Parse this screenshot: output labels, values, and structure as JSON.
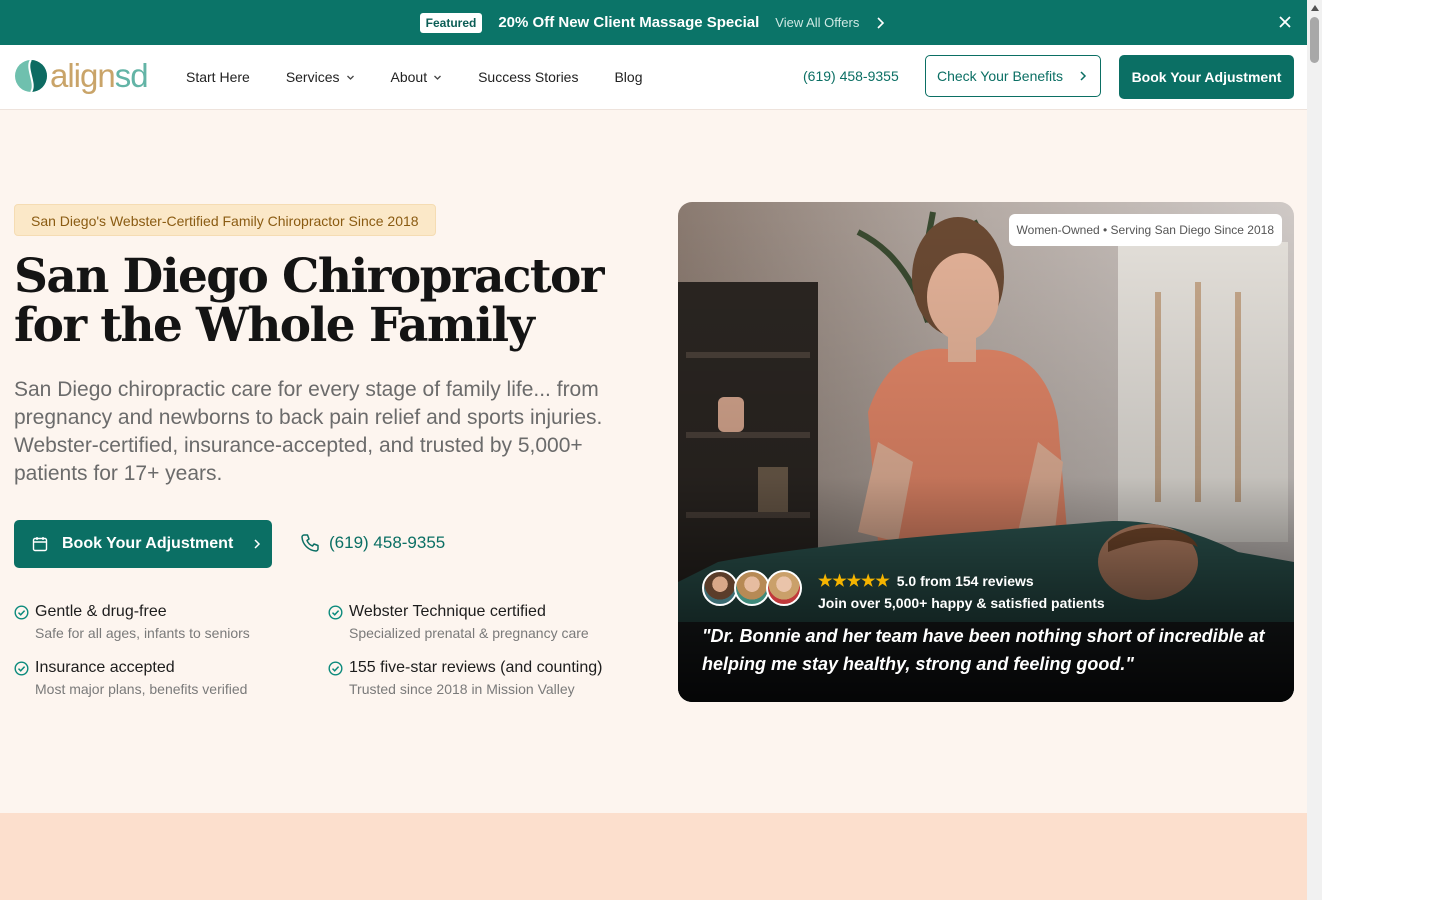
{
  "promo": {
    "badge": "Featured",
    "headline": "20% Off New Client Massage Special",
    "link": "View All Offers"
  },
  "nav": {
    "logo": {
      "part1": "align",
      "part2": "sd"
    },
    "items": [
      {
        "label": "Start Here",
        "has_caret": false
      },
      {
        "label": "Services",
        "has_caret": true
      },
      {
        "label": "About",
        "has_caret": true
      },
      {
        "label": "Success Stories",
        "has_caret": false
      },
      {
        "label": "Blog",
        "has_caret": false
      }
    ],
    "phone": "(619) 458-9355",
    "benefits_label": "Check Your Benefits",
    "book_label": "Book Your Adjustment"
  },
  "hero": {
    "tagline": "San Diego's Webster-Certified Family Chiropractor Since 2018",
    "title_line1": "San Diego Chiropractor",
    "title_line2": "for the Whole Family",
    "lead": "San Diego chiropractic care for every stage of family life... from pregnancy and newborns to back pain relief and sports injuries. Webster-certified, insurance-accepted, and trusted by 5,000+ patients for 17+ years.",
    "book_label": "Book Your Adjustment",
    "phone": "(619) 458-9355",
    "features": [
      {
        "title": "Gentle & drug-free",
        "sub": "Safe for all ages, infants to seniors"
      },
      {
        "title": "Webster Technique certified",
        "sub": "Specialized prenatal & pregnancy care"
      },
      {
        "title": "Insurance accepted",
        "sub": "Most major plans, benefits verified"
      },
      {
        "title": "155 five-star reviews (and counting)",
        "sub": "Trusted since 2018 in Mission Valley"
      }
    ]
  },
  "photo": {
    "badge": "Women-Owned • Serving San Diego Since 2018",
    "stars": "★★★★★",
    "rating_text": "5.0 from 154 reviews",
    "join_text": "Join over 5,000+ happy & satisfied patients",
    "quote": "\"Dr. Bonnie and her team have been nothing short of incredible at helping me stay healthy, strong and feeling good.\""
  },
  "colors": {
    "brand_teal": "#0b6f64",
    "promo_teal": "#0b7468",
    "hero_bg": "#fdf5ef",
    "tag_bg": "#fbe8c8",
    "lower_bg": "#fcdfcd"
  }
}
